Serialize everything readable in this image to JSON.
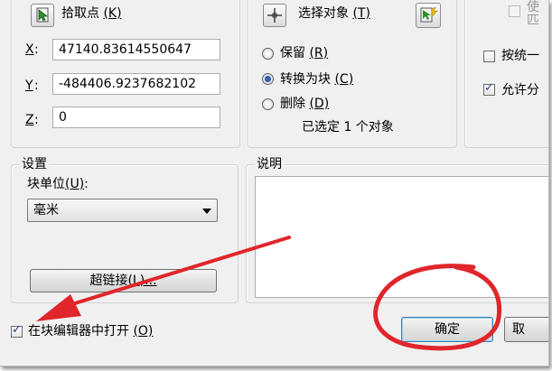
{
  "base_point": {
    "pick_label": "拾取点",
    "pick_key": "(K)",
    "x_key": "X",
    "x_value": "47140.83614550647",
    "y_key": "Y",
    "y_value": "-484406.9237682102",
    "z_key": "Z",
    "z_value": "0"
  },
  "objects": {
    "select_label": "选择对象",
    "select_key": "(T)",
    "retain_label": "保留",
    "retain_key": "(R)",
    "convert_label": "转换为块",
    "convert_key": "(C)",
    "delete_label": "删除",
    "delete_key": "(D)",
    "selected_text": "已选定 1 个对象"
  },
  "behavior": {
    "annotative_partial": "使",
    "annotative_partial2": "匹",
    "scale_uniform_label": "按统一",
    "allow_explode_label": "允许分"
  },
  "settings": {
    "group_label": "设置",
    "block_unit_label": "块单位",
    "block_unit_key": "(U)",
    "block_unit_value": "毫米",
    "hyperlink_label": "超链接",
    "hyperlink_key": "(L)..."
  },
  "description": {
    "group_label": "说明"
  },
  "footer": {
    "open_editor_label": "在块编辑器中打开",
    "open_editor_key": "(O)",
    "ok_label": "确定",
    "cancel_partial": "取"
  },
  "colors": {
    "annotation_red": "#e0262a",
    "dialog_bg": "#f0f0f0"
  }
}
